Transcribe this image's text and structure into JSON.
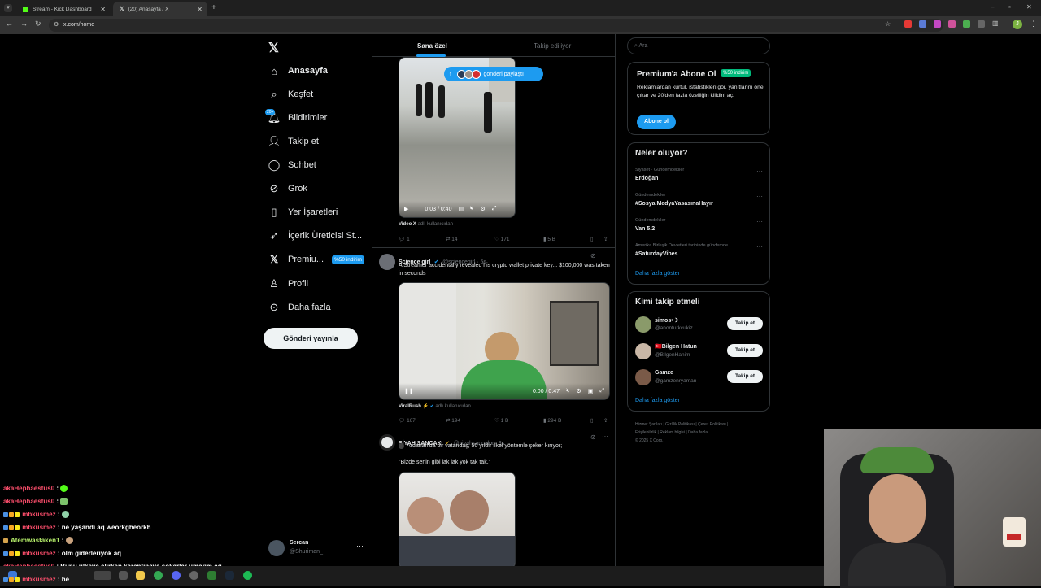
{
  "browser": {
    "tabs": [
      {
        "title": "Stream - Kick Dashboard",
        "active": false
      },
      {
        "title": "(20) Anasayfa / X",
        "active": true
      }
    ],
    "url": "x.com/home",
    "profile_initial": "J"
  },
  "sidebar": {
    "items": [
      {
        "label": "Anasayfa",
        "icon": "home-icon"
      },
      {
        "label": "Keşfet",
        "icon": "search-icon"
      },
      {
        "label": "Bildirimler",
        "icon": "bell-icon",
        "badge": "20+"
      },
      {
        "label": "Takip et",
        "icon": "add-user-icon"
      },
      {
        "label": "Sohbet",
        "icon": "chat-icon"
      },
      {
        "label": "Grok",
        "icon": "grok-icon"
      },
      {
        "label": "Yer İşaretleri",
        "icon": "bookmark-icon"
      },
      {
        "label": "İçerik Üreticisi St...",
        "icon": "rocket-icon"
      },
      {
        "label": "Premiu...",
        "icon": "x-logo-icon",
        "badge": "%50 indirim"
      },
      {
        "label": "Profil",
        "icon": "person-icon"
      },
      {
        "label": "Daha fazla",
        "icon": "more-circle-icon"
      }
    ],
    "post_button": "Gönderi yayınla",
    "account": {
      "name": "Sercan",
      "handle": "@Shuriman_"
    }
  },
  "feed": {
    "tabs": [
      "Sana özel",
      "Takip ediliyor"
    ],
    "new_posts_pill": "gönderi paylaştı",
    "post1": {
      "video_time": "0:03 / 0:40",
      "source_label": "Video X",
      "source_suffix": "adlı kullanıcıdan",
      "replies": "1",
      "reposts": "14",
      "likes": "171",
      "views": "5 B"
    },
    "post2": {
      "name": "Science girl",
      "handle": "@sciencegirl · 5s",
      "text": "A Streamer accidentally revealed his crypto wallet private key... $100,000 was taken in seconds",
      "video_time": "0:00 / 0:47",
      "source_label": "ViralRush ⚡",
      "source_suffix": "adlı kullanıcıdan",
      "replies": "167",
      "reposts": "194",
      "likes": "1 B",
      "views": "294 B"
    },
    "post3": {
      "name": "SİYAH SANCAK",
      "handle": "@siyahsancakx · 3s",
      "text1": "Ardahan'da bir vatandaş, 50 yıldır ilkel yöntemle şeker kırıyor;",
      "text2": "\"Bizde senin gibi lak lak yok tak tak.\""
    }
  },
  "right": {
    "search_placeholder": "Ara",
    "premium": {
      "title": "Premium'a Abone Ol",
      "badge": "%50 indirim",
      "text": "Reklamlardan kurtul, istatistikleri gör, yanıtlarını öne çıkar ve 20'den fazla özelliğin kilidini aç.",
      "button": "Abone ol"
    },
    "trends": {
      "title": "Neler oluyor?",
      "items": [
        {
          "category": "Siyaset · Gündemdekiler",
          "title": "Erdoğan"
        },
        {
          "category": "Gündemdekiler",
          "title": "#SosyalMedyaYasasınaHayır"
        },
        {
          "category": "Gündemdekiler",
          "title": "Van 5.2"
        },
        {
          "category": "Amerika Birleşik Devletleri tarihinde gündemde",
          "title": "#SaturdayVibes"
        }
      ],
      "more": "Daha fazla göster"
    },
    "who_to_follow": {
      "title": "Kimi takip etmeli",
      "users": [
        {
          "name": "simos•☽",
          "handle": "@anonturkcukiz",
          "button": "Takip et"
        },
        {
          "name": "🇹🇷Bilgen Hatun",
          "handle": "@BilgenHanim",
          "button": "Takip et"
        },
        {
          "name": "Gamze",
          "handle": "@gamzenryaman",
          "button": "Takip et"
        }
      ],
      "more": "Daha fazla göster"
    },
    "footer": [
      "Hizmet Şartları",
      "Gizlilik Politikası",
      "Çerez Politikası",
      "Erişilebilirlik",
      "Reklam bilgisi",
      "Daha fazla ...",
      "© 2025 X Corp."
    ]
  },
  "chat": {
    "messages": [
      {
        "user": "akaHephaestus0",
        "text": ""
      },
      {
        "user": "akaHephaestus0",
        "text": ""
      },
      {
        "user": "mbkusmez",
        "text": ""
      },
      {
        "user": "mbkusmez",
        "text": "ne yaşandı aq weorkgheorkh"
      },
      {
        "user": "Atemwastaken1",
        "text": ""
      },
      {
        "user": "mbkusmez",
        "text": "olm giderleriyok aq"
      },
      {
        "user": "akaHephaestus0",
        "text": "Bunu ülkeye alırken karantinaya sokarlar umarım aq"
      },
      {
        "user": "mbkusmez",
        "text": "he"
      }
    ]
  },
  "colors": {
    "accent": "#1d9bf0",
    "bg": "#000000",
    "border": "#2f3336",
    "muted": "#71767b",
    "verified": "#1d9bf0"
  }
}
